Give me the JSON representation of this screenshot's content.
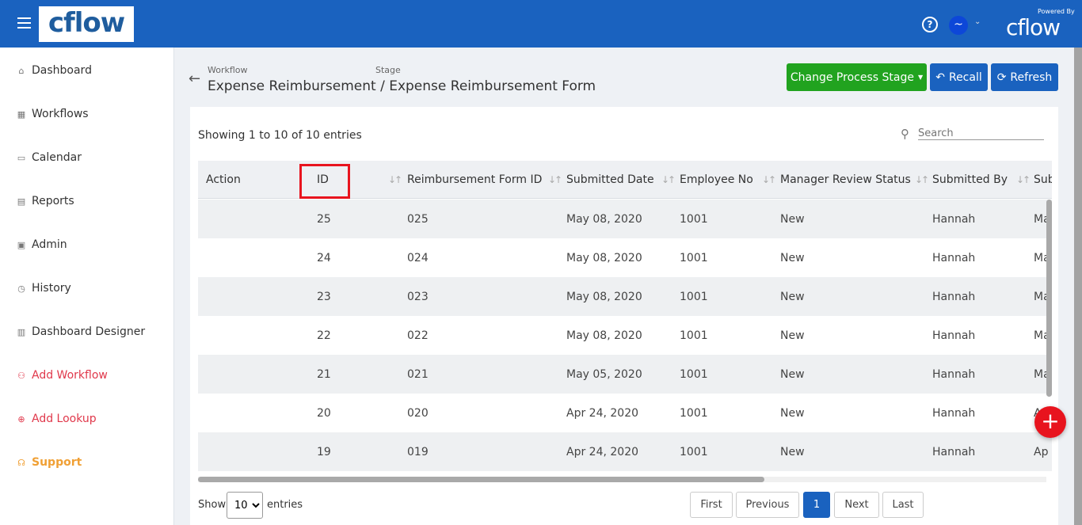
{
  "header": {
    "logo": "cflow",
    "help_icon": "?",
    "avatar_icon": "~",
    "powered_by": "Powered By",
    "powered_logo": "cflow"
  },
  "sidebar": {
    "items": [
      {
        "label": "Dashboard",
        "icon": "home-icon"
      },
      {
        "label": "Workflows",
        "icon": "grid-icon"
      },
      {
        "label": "Calendar",
        "icon": "calendar-icon"
      },
      {
        "label": "Reports",
        "icon": "reports-icon"
      },
      {
        "label": "Admin",
        "icon": "admin-icon"
      },
      {
        "label": "History",
        "icon": "history-icon"
      },
      {
        "label": "Dashboard Designer",
        "icon": "designer-icon"
      },
      {
        "label": "Add Workflow",
        "icon": "sitemap-icon"
      },
      {
        "label": "Add Lookup",
        "icon": "crosshair-icon"
      },
      {
        "label": "Support",
        "icon": "headset-icon"
      }
    ]
  },
  "breadcrumb": {
    "workflow_label": "Workflow",
    "stage_label": "Stage",
    "workflow": "Expense Reimbursement",
    "separator": "/",
    "stage": "Expense Reimbursement Form"
  },
  "toolbar": {
    "change_stage": "Change Process Stage",
    "recall": "Recall",
    "refresh": "Refresh",
    "colors": {
      "change_stage": "#21a31f",
      "primary": "#1a62bf"
    }
  },
  "table": {
    "info": "Showing 1 to 10 of 10 entries",
    "search_placeholder": "Search",
    "columns": [
      "Action",
      "ID",
      "Reimbursement Form ID",
      "Submitted Date",
      "Employee No",
      "Manager Review Status",
      "Submitted By",
      "Sub"
    ],
    "rows": [
      {
        "id": "25",
        "form_id": "025",
        "date": "May 08, 2020",
        "emp": "1001",
        "status": "New",
        "by": "Hannah",
        "sub": "Ma"
      },
      {
        "id": "24",
        "form_id": "024",
        "date": "May 08, 2020",
        "emp": "1001",
        "status": "New",
        "by": "Hannah",
        "sub": "Ma"
      },
      {
        "id": "23",
        "form_id": "023",
        "date": "May 08, 2020",
        "emp": "1001",
        "status": "New",
        "by": "Hannah",
        "sub": "Ma"
      },
      {
        "id": "22",
        "form_id": "022",
        "date": "May 08, 2020",
        "emp": "1001",
        "status": "New",
        "by": "Hannah",
        "sub": "Ma"
      },
      {
        "id": "21",
        "form_id": "021",
        "date": "May 05, 2020",
        "emp": "1001",
        "status": "New",
        "by": "Hannah",
        "sub": "Ma"
      },
      {
        "id": "20",
        "form_id": "020",
        "date": "Apr 24, 2020",
        "emp": "1001",
        "status": "New",
        "by": "Hannah",
        "sub": "A"
      },
      {
        "id": "19",
        "form_id": "019",
        "date": "Apr 24, 2020",
        "emp": "1001",
        "status": "New",
        "by": "Hannah",
        "sub": "Ap"
      }
    ]
  },
  "footer": {
    "show": "Show",
    "page_size": "10",
    "entries": "entries",
    "first": "First",
    "previous": "Previous",
    "page": "1",
    "next": "Next",
    "last": "Last"
  },
  "fab": "+"
}
